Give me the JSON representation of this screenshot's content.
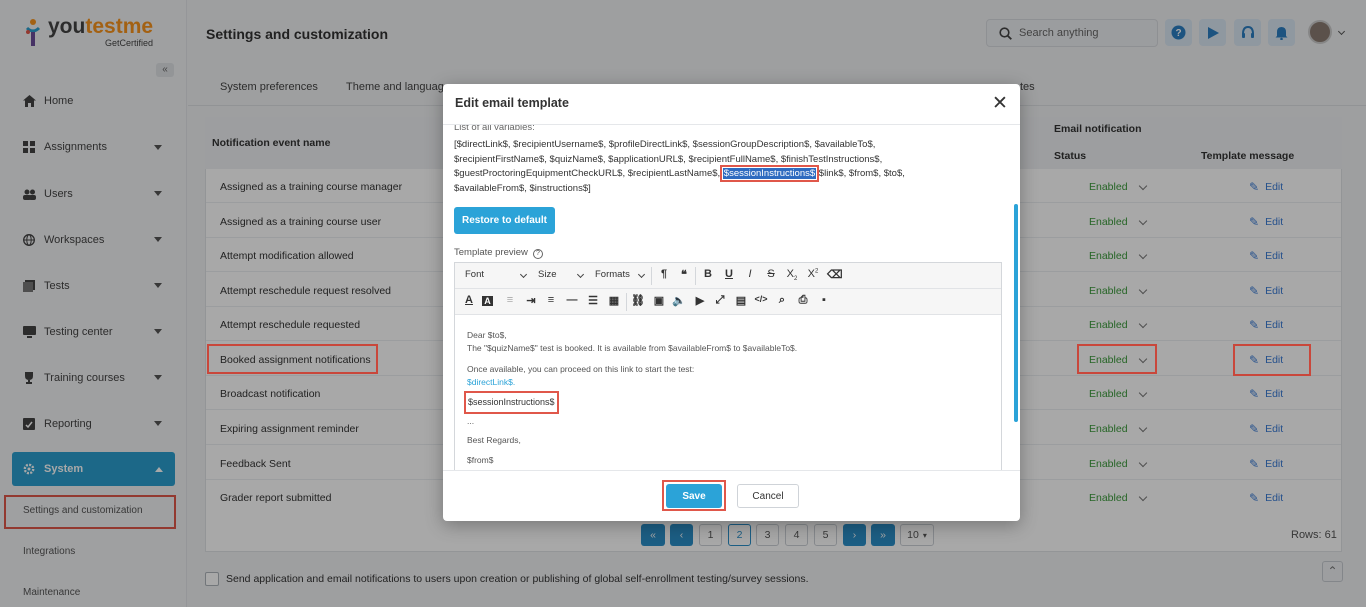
{
  "brand": {
    "name_part1": "you",
    "name_part2": "testme",
    "tagline": "GetCertified"
  },
  "sidebar": {
    "collapse_glyph": "«",
    "items": [
      {
        "label": "Home",
        "icon": "home-icon"
      },
      {
        "label": "Assignments",
        "icon": "assignments-icon"
      },
      {
        "label": "Users",
        "icon": "users-icon"
      },
      {
        "label": "Workspaces",
        "icon": "globe-icon"
      },
      {
        "label": "Tests",
        "icon": "tests-icon"
      },
      {
        "label": "Testing center",
        "icon": "monitor-icon"
      },
      {
        "label": "Training courses",
        "icon": "trophy-icon"
      },
      {
        "label": "Reporting",
        "icon": "reporting-icon"
      }
    ],
    "system_label": "System",
    "sub_items": [
      "Settings and customization",
      "Integrations",
      "Maintenance"
    ]
  },
  "header": {
    "title": "Settings and customization",
    "search_placeholder": "Search anything"
  },
  "tabs": [
    "System preferences",
    "Theme and language",
    "tes"
  ],
  "table": {
    "col_name": "Notification event name",
    "col_email": "Email notification",
    "col_status": "Status",
    "col_template": "Template message",
    "rows": [
      {
        "name": "Assigned as a training course manager",
        "status": "Enabled",
        "action": "Edit"
      },
      {
        "name": "Assigned as a training course user",
        "status": "Enabled",
        "action": "Edit"
      },
      {
        "name": "Attempt modification allowed",
        "status": "Enabled",
        "action": "Edit"
      },
      {
        "name": "Attempt reschedule request resolved",
        "status": "Enabled",
        "action": "Edit"
      },
      {
        "name": "Attempt reschedule requested",
        "status": "Enabled",
        "action": "Edit"
      },
      {
        "name": "Booked assignment notifications",
        "status": "Enabled",
        "action": "Edit"
      },
      {
        "name": "Broadcast notification",
        "status": "Enabled",
        "action": "Edit"
      },
      {
        "name": "Expiring assignment reminder",
        "status": "Enabled",
        "action": "Edit"
      },
      {
        "name": "Feedback Sent",
        "status": "Enabled",
        "action": "Edit"
      },
      {
        "name": "Grader report submitted",
        "status": "Enabled",
        "action": "Edit"
      }
    ]
  },
  "pagination": {
    "first": "«",
    "prev": "‹",
    "pages": [
      "1",
      "2",
      "3",
      "4",
      "5"
    ],
    "current": "2",
    "next": "›",
    "last": "»",
    "page_size": "10",
    "rows_text": "Rows: 61"
  },
  "notify_checkbox_label": "Send application and email notifications to users upon creation or publishing of global self-enrollment testing/survey sessions.",
  "modal": {
    "title": "Edit email template",
    "close_glyph": "✕",
    "vars_label": "List of all variables:",
    "vars_line1": "[$directLink$, $recipientUsername$, $profileDirectLink$, $sessionGroupDescription$, $availableTo$,",
    "vars_line2": "$recipientFirstName$, $quizName$, $applicationURL$, $recipientFullName$, $finishTestInstructions$,",
    "vars_line3_pre": "$guestProctoringEquipmentCheckURL$, $recipientLastName$, ",
    "vars_highlight": "$sessionInstructions$",
    "vars_line3_post": " $link$, $from$, $to$,",
    "vars_line4": "$availableFrom$, $instructions$]",
    "restore_label": "Restore to default",
    "preview_label": "Template preview",
    "toolbar": {
      "font": "Font",
      "size": "Size",
      "formats": "Formats"
    },
    "content": {
      "line1": "Dear $to$,",
      "line2": "The \"$quizName$\" test is booked. It is available from $availableFrom$ to $availableTo$.",
      "line3": "Once available, you can proceed on this link to start the test:",
      "line4": "$directLink$.",
      "line5": "$sessionInstructions$",
      "line6": "...",
      "line7": "Best Regards,",
      "line8": "$from$"
    },
    "save_label": "Save",
    "cancel_label": "Cancel"
  },
  "colors": {
    "accent": "#2ba3d8",
    "highlight_box": "#e0574a",
    "enabled": "#3a9a3a",
    "link": "#3a7bd5"
  }
}
